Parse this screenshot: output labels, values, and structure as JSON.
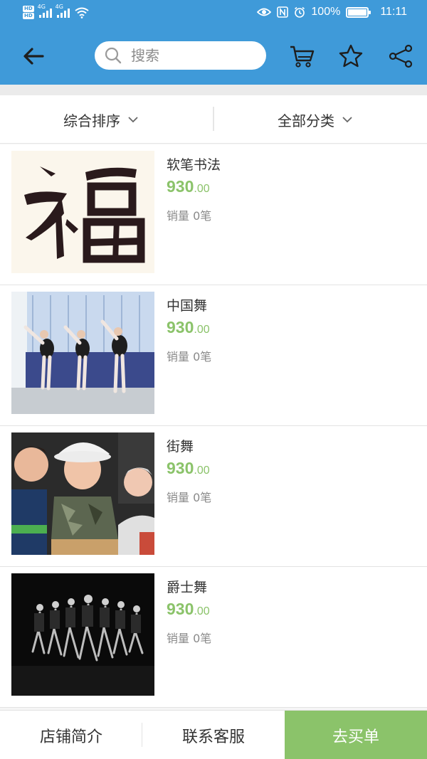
{
  "status_bar": {
    "network_1": "4G",
    "network_2": "4G",
    "battery": "100%",
    "time": "11:11"
  },
  "header": {
    "search_placeholder": "搜索",
    "icons": [
      "back-arrow-icon",
      "search-icon",
      "cart-icon",
      "star-icon",
      "share-icon"
    ]
  },
  "filters": {
    "sort_label": "综合排序",
    "category_label": "全部分类"
  },
  "products": [
    {
      "title": "软笔书法",
      "price_int": "930",
      "price_dec": ".00",
      "sales": "销量 0笔"
    },
    {
      "title": "中国舞",
      "price_int": "930",
      "price_dec": ".00",
      "sales": "销量 0笔"
    },
    {
      "title": "街舞",
      "price_int": "930",
      "price_dec": ".00",
      "sales": "销量 0笔"
    },
    {
      "title": "爵士舞",
      "price_int": "930",
      "price_dec": ".00",
      "sales": "销量 0笔"
    }
  ],
  "bottom_bar": {
    "shop_intro": "店铺简介",
    "contact_service": "联系客服",
    "buy": "去买单"
  },
  "colors": {
    "header_blue": "#3f9ad9",
    "price_green": "#8bc36a",
    "buy_green": "#8bc36a"
  }
}
